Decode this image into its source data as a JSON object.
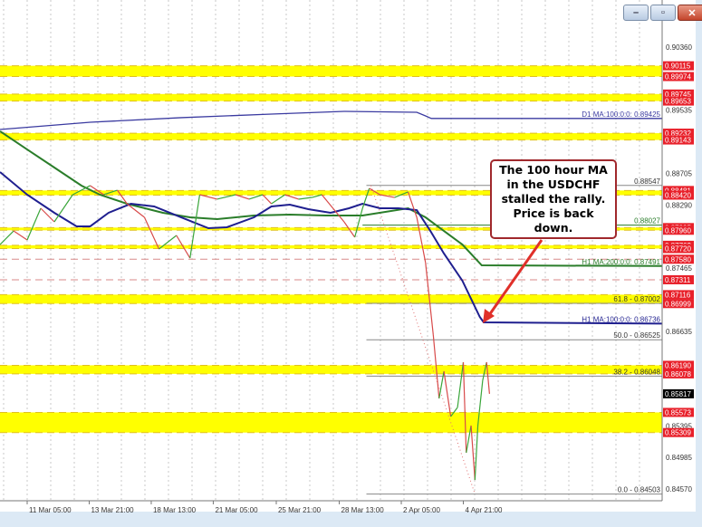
{
  "window": {
    "buttons": [
      "minimize",
      "maximize",
      "close"
    ]
  },
  "annotation": {
    "text": "The 100 hour MA in the USDCHF stalled the rally. Price is back down."
  },
  "colors": {
    "band": "#ffff00",
    "level": "#e8202a",
    "ma100h": "#1f1f8f",
    "ma200h": "#2a7d2a",
    "d1ma": "#3a3aa0",
    "bull": "#3aa63a",
    "bear": "#d84a4a",
    "arrow": "#e0302a"
  },
  "chart_data": {
    "type": "line",
    "symbol": "USDCHF",
    "ylim": [
      0.8435,
      0.907
    ],
    "y_ticks": [
      "0.90360",
      "0.89535",
      "0.88705",
      "0.88290",
      "0.87465",
      "0.86635",
      "0.85395",
      "0.84985",
      "0.84570"
    ],
    "x_ticks": [
      {
        "i": 0,
        "label": "11 Mar 05:00"
      },
      {
        "i": 64,
        "label": "13 Mar 21:00"
      },
      {
        "i": 128,
        "label": "18 Mar 13:00"
      },
      {
        "i": 192,
        "label": "21 Mar 05:00"
      },
      {
        "i": 257,
        "label": "25 Mar 21:00"
      },
      {
        "i": 322,
        "label": "28 Mar 13:00"
      },
      {
        "i": 386,
        "label": "2 Apr 05:00"
      },
      {
        "i": 450,
        "label": "4 Apr 21:00"
      }
    ],
    "current_price": "0.85817",
    "bands": [
      [
        "0.90115",
        "0.89974"
      ],
      [
        "0.89745",
        "0.89653"
      ],
      [
        "0.89232",
        "0.89143"
      ],
      [
        "0.88481",
        "0.88420"
      ],
      [
        "0.87995",
        "0.87960"
      ],
      [
        "0.87763",
        "0.87720"
      ],
      [
        "0.87116",
        "0.86999"
      ],
      [
        "0.86190",
        "0.86078"
      ],
      [
        "0.85573",
        "0.85309"
      ]
    ],
    "single_levels": [
      "0.87580",
      "0.87311"
    ],
    "fib": {
      "high": 0.88547,
      "low": 0.84503,
      "start_i": 350,
      "levels": [
        {
          "label": "0.0 - 0.84503",
          "price": 0.84503
        },
        {
          "label": "38.2 - 0.86048",
          "price": 0.86048
        },
        {
          "label": "50.0 - 0.86525",
          "price": 0.86525
        },
        {
          "label": "61.8 - 0.87002",
          "price": 0.87002
        },
        {
          "label": "0.88547",
          "price": 0.88547
        }
      ]
    },
    "green_level": {
      "label": "0.88027",
      "price": 0.88027
    },
    "series": [
      {
        "name": "D1 MA:100:0:0: 0.89425",
        "last": 0.89425,
        "points": [
          [
            -28,
            0.8928
          ],
          [
            65,
            0.89375
          ],
          [
            159,
            0.89435
          ],
          [
            252,
            0.89482
          ],
          [
            327,
            0.89518
          ],
          [
            402,
            0.89506
          ],
          [
            411,
            0.89458
          ],
          [
            417,
            0.89425
          ]
        ]
      },
      {
        "name": "H1 MA:200:0:0: 0.87491",
        "last": 0.87491,
        "points": [
          [
            -28,
            0.89257
          ],
          [
            0,
            0.89019
          ],
          [
            28,
            0.88782
          ],
          [
            56,
            0.88545
          ],
          [
            75,
            0.88426
          ],
          [
            103,
            0.88307
          ],
          [
            140,
            0.88189
          ],
          [
            168,
            0.88129
          ],
          [
            196,
            0.88106
          ],
          [
            234,
            0.88153
          ],
          [
            271,
            0.88165
          ],
          [
            308,
            0.88153
          ],
          [
            346,
            0.88153
          ],
          [
            393,
            0.88248
          ],
          [
            411,
            0.88129
          ],
          [
            430,
            0.87951
          ],
          [
            449,
            0.87773
          ],
          [
            469,
            0.875
          ]
        ]
      },
      {
        "name": "H1 MA:100:0:0: 0.86736",
        "last": 0.86736,
        "points": [
          [
            -28,
            0.88723
          ],
          [
            0,
            0.88426
          ],
          [
            28,
            0.88189
          ],
          [
            51,
            0.88011
          ],
          [
            65,
            0.88011
          ],
          [
            84,
            0.88189
          ],
          [
            107,
            0.88307
          ],
          [
            131,
            0.88272
          ],
          [
            159,
            0.88129
          ],
          [
            187,
            0.87987
          ],
          [
            206,
            0.87999
          ],
          [
            234,
            0.88129
          ],
          [
            252,
            0.88272
          ],
          [
            271,
            0.88295
          ],
          [
            290,
            0.88236
          ],
          [
            313,
            0.88189
          ],
          [
            332,
            0.88248
          ],
          [
            346,
            0.88307
          ],
          [
            364,
            0.88248
          ],
          [
            383,
            0.88248
          ],
          [
            402,
            0.88224
          ],
          [
            416,
            0.87951
          ],
          [
            430,
            0.87655
          ],
          [
            449,
            0.87299
          ],
          [
            467,
            0.86824
          ],
          [
            471,
            0.86753
          ]
        ]
      },
      {
        "name": "price",
        "points": [
          [
            -28,
            0.87773
          ],
          [
            -14,
            0.87951
          ],
          [
            0,
            0.87833
          ],
          [
            14,
            0.88248
          ],
          [
            28,
            0.8807
          ],
          [
            47,
            0.88426
          ],
          [
            65,
            0.88545
          ],
          [
            79,
            0.88426
          ],
          [
            93,
            0.88485
          ],
          [
            103,
            0.88307
          ],
          [
            121,
            0.88129
          ],
          [
            136,
            0.87714
          ],
          [
            154,
            0.87892
          ],
          [
            168,
            0.87595
          ],
          [
            173,
            0.88011
          ],
          [
            178,
            0.88426
          ],
          [
            196,
            0.88367
          ],
          [
            215,
            0.88426
          ],
          [
            229,
            0.88367
          ],
          [
            243,
            0.88426
          ],
          [
            252,
            0.88307
          ],
          [
            266,
            0.88426
          ],
          [
            280,
            0.88367
          ],
          [
            294,
            0.8839
          ],
          [
            304,
            0.88426
          ],
          [
            327,
            0.8807
          ],
          [
            338,
            0.87868
          ],
          [
            346,
            0.88248
          ],
          [
            353,
            0.88509
          ],
          [
            364,
            0.88426
          ],
          [
            379,
            0.8839
          ],
          [
            393,
            0.88462
          ],
          [
            402,
            0.88129
          ],
          [
            411,
            0.87536
          ],
          [
            419,
            0.86587
          ],
          [
            425,
            0.85756
          ],
          [
            430,
            0.86112
          ],
          [
            437,
            0.85519
          ],
          [
            444,
            0.85638
          ],
          [
            450,
            0.86231
          ],
          [
            453,
            0.85044
          ],
          [
            458,
            0.854
          ],
          [
            462,
            0.84688
          ],
          [
            465,
            0.854
          ],
          [
            470,
            0.85994
          ],
          [
            474,
            0.86231
          ],
          [
            477,
            0.85817
          ]
        ]
      }
    ]
  }
}
